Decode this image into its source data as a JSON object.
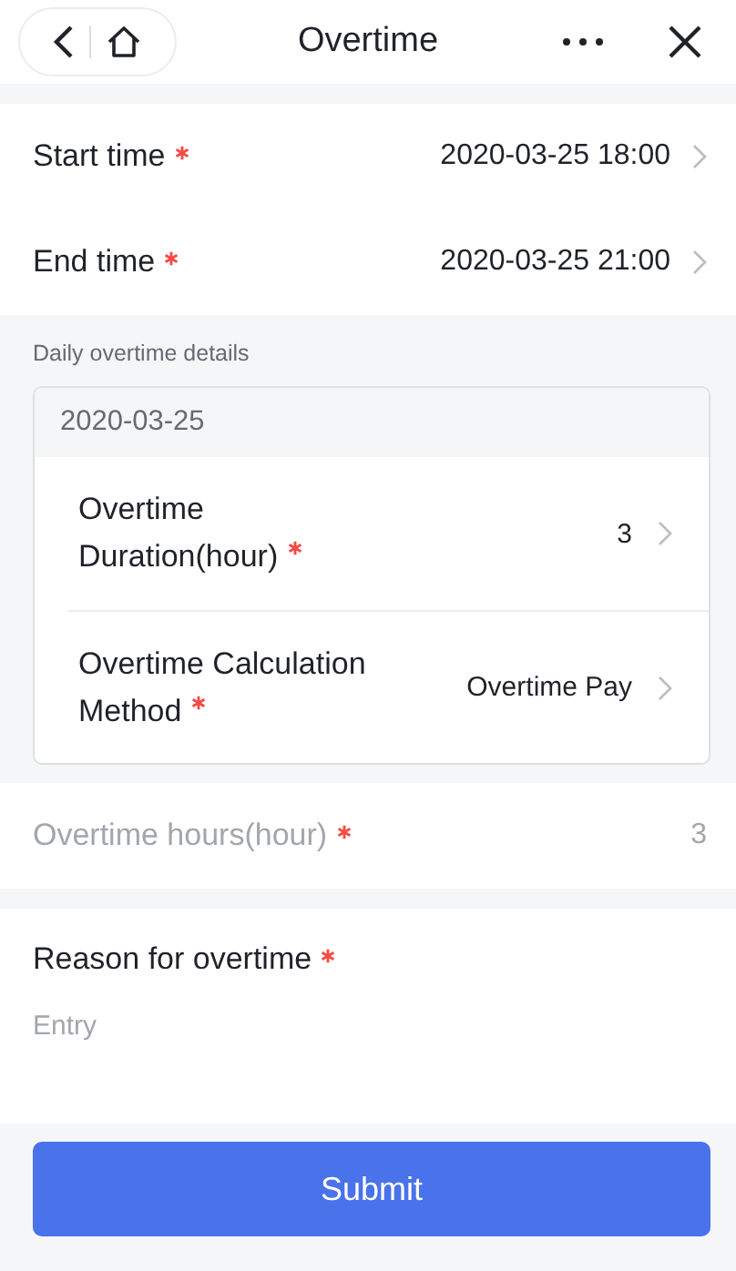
{
  "nav": {
    "title": "Overtime"
  },
  "fields": [
    {
      "label": "Start time",
      "required": true,
      "value": "2020-03-25 18:00",
      "disabled": false
    },
    {
      "label": "End time",
      "required": true,
      "value": "2020-03-25 21:00",
      "disabled": false
    }
  ],
  "details": {
    "heading": "Daily overtime details",
    "days": [
      {
        "date": "2020-03-25",
        "items": [
          {
            "label": "Overtime Duration(hour)",
            "required": true,
            "value": "3"
          },
          {
            "label": "Overtime Calculation Method",
            "required": true,
            "value": "Overtime Pay"
          }
        ]
      }
    ]
  },
  "total": {
    "label": "Overtime hours(hour)",
    "required": true,
    "value": "3",
    "disabled": true
  },
  "reason": {
    "label": "Reason for overtime",
    "required": true,
    "placeholder": "Entry"
  },
  "submit": {
    "label": "Submit"
  }
}
